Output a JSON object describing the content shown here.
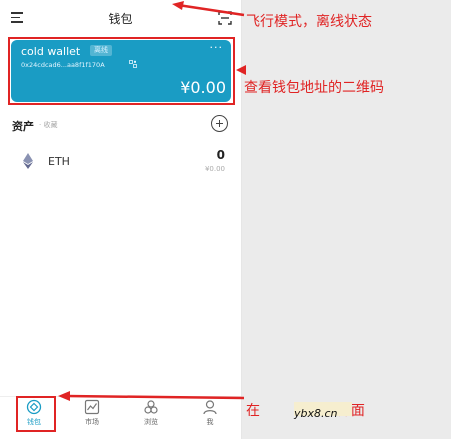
{
  "header": {
    "title": "钱包"
  },
  "wallet_card": {
    "name": "cold wallet",
    "badge": "离线",
    "address": "0x24cdcad6...aa8f1f170A",
    "balance": "¥0.00",
    "more": "···",
    "color": "#1a9cc4"
  },
  "assets": {
    "title": "资产",
    "subtitle": "· 收藏"
  },
  "tokens": [
    {
      "symbol": "ETH",
      "amount": "0",
      "fiat": "¥0.00"
    }
  ],
  "nav": [
    {
      "label": "钱包",
      "icon": "wallet-icon",
      "active": true
    },
    {
      "label": "市场",
      "icon": "chart-icon"
    },
    {
      "label": "浏览",
      "icon": "browse-icon"
    },
    {
      "label": "我",
      "icon": "user-icon"
    }
  ],
  "annotations": {
    "top": "飞行模式，离线状态",
    "card": "查看钱包地址的二维码",
    "bottom_prefix": "在",
    "bottom_suffix": "界面",
    "watermark": "ybx8.cn"
  },
  "colors": {
    "annotation": "#e02424",
    "accent": "#1a9cc4"
  }
}
